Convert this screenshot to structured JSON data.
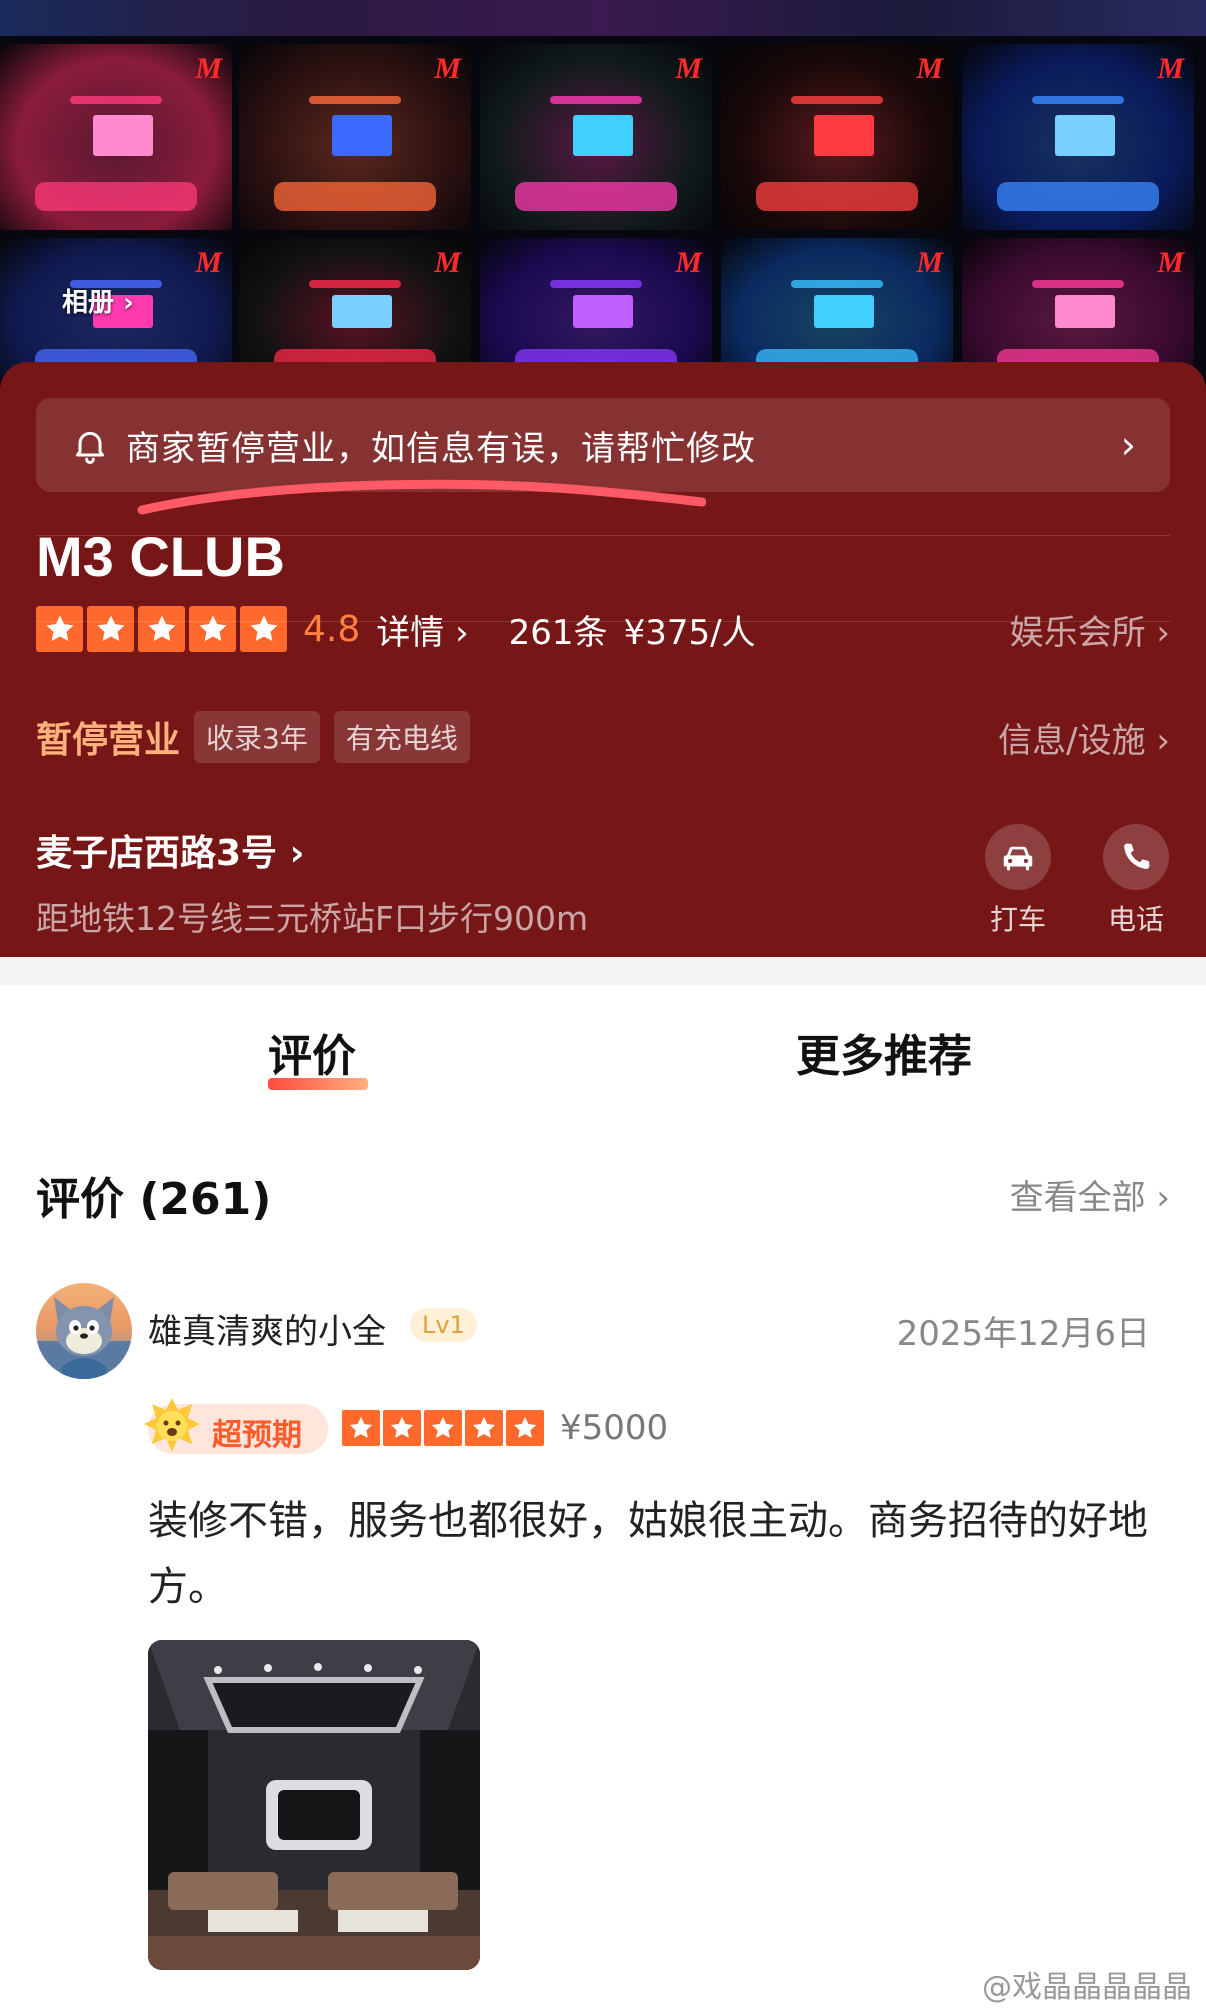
{
  "gallery": {
    "album_label": "相册",
    "chevron": "›",
    "tiles": [
      {
        "color": "#8a1c3a",
        "accent": "#ff3a7a",
        "screen": "#ff8ad0"
      },
      {
        "color": "#2a1010",
        "accent": "#ff6a3a",
        "screen": "#3a6aff"
      },
      {
        "color": "#101a1a",
        "accent": "#ff3ab0",
        "screen": "#40d0ff"
      },
      {
        "color": "#180808",
        "accent": "#ff4040",
        "screen": "#ff3a40"
      },
      {
        "color": "#0a1a5a",
        "accent": "#3a8aff",
        "screen": "#7ad0ff"
      },
      {
        "color": "#101a50",
        "accent": "#4a6aff",
        "screen": "#ff3ab0"
      },
      {
        "color": "#121212",
        "accent": "#ff2a4a",
        "screen": "#7ad0ff"
      },
      {
        "color": "#1a0a50",
        "accent": "#8a3aff",
        "screen": "#c060ff"
      },
      {
        "color": "#0a2a60",
        "accent": "#3ac0ff",
        "screen": "#40d0ff"
      },
      {
        "color": "#3a0a30",
        "accent": "#ff3a9a",
        "screen": "#ff8ad0"
      }
    ]
  },
  "notice": {
    "icon": "bell-icon",
    "text": "商家暂停营业，如信息有误，请帮忙修改",
    "chevron": "›"
  },
  "shop": {
    "name": "M3 CLUB",
    "stars": 5,
    "score": "4.8",
    "detail_label": "详情 ›",
    "review_count": "261条",
    "price_per_person": "¥375/人",
    "category": "娱乐会所 ›",
    "status": "暂停营业",
    "tags": [
      "收录3年",
      "有充电线"
    ],
    "info_link": "信息/设施 ›",
    "address": "麦子店西路3号 ›",
    "metro": "距地铁12号线三元桥站F口步行900m",
    "actions": [
      {
        "icon": "car-icon",
        "label": "打车"
      },
      {
        "icon": "phone-icon",
        "label": "电话"
      }
    ]
  },
  "colors": {
    "header_bg": "#761616",
    "accent_orange": "#ff6a2c",
    "status_orange": "#ffb27d",
    "highlight_red": "#ff4a3d"
  },
  "tabs": [
    {
      "label": "评价",
      "active": true
    },
    {
      "label": "更多推荐",
      "active": false
    }
  ],
  "reviews": {
    "title": "评价 (261)",
    "see_all": "查看全部 ›",
    "items": [
      {
        "user": "雄真清爽的小全",
        "level": "Lv1",
        "date": "2025年12月6日",
        "badge": "超预期",
        "stars": 5,
        "price": "¥5000",
        "text": "装修不错，服务也都很好，姑娘很主动。商务招待的好地方。"
      }
    ]
  },
  "watermark": "@戏晶晶晶晶晶"
}
